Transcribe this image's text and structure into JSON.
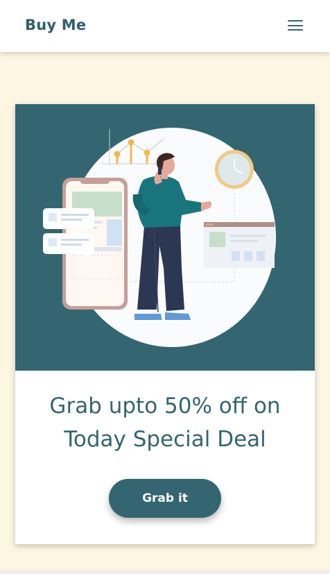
{
  "header": {
    "brand": "Buy Me",
    "menu_icon": "hamburger-menu-icon"
  },
  "promo": {
    "illustration": "person-on-phone-illustration",
    "headline_line1": "Grab upto 50% off on",
    "headline_line2": "Today Special Deal",
    "cta_label": "Grab it"
  },
  "colors": {
    "brand": "#336670",
    "page_background": "#fdf6e3",
    "card_background": "#ffffff",
    "hero_background": "#336670"
  }
}
